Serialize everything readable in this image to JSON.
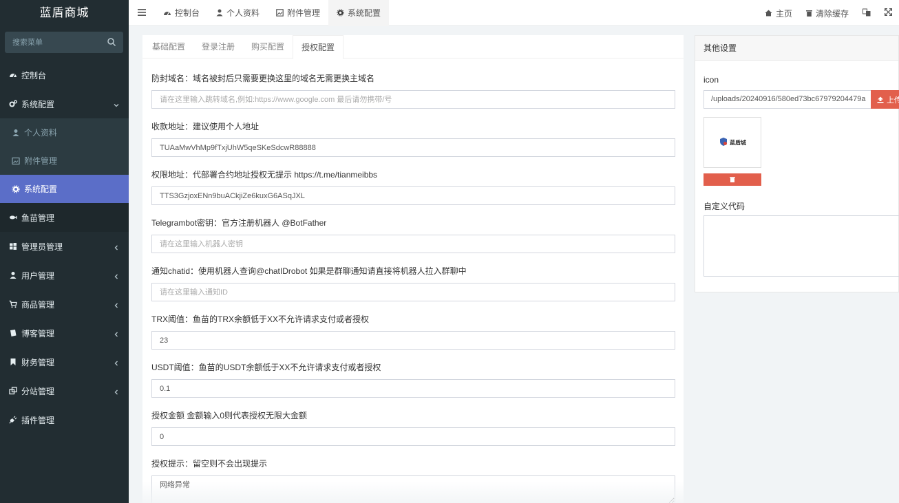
{
  "brand": "蓝盾商城",
  "sidebar": {
    "search_placeholder": "搜索菜单",
    "items": [
      {
        "label": "控制台"
      },
      {
        "label": "系统配置"
      },
      {
        "label": "个人资料"
      },
      {
        "label": "附件管理"
      },
      {
        "label": "系统配置"
      },
      {
        "label": "鱼苗管理"
      },
      {
        "label": "管理员管理"
      },
      {
        "label": "用户管理"
      },
      {
        "label": "商品管理"
      },
      {
        "label": "博客管理"
      },
      {
        "label": "财务管理"
      },
      {
        "label": "分站管理"
      },
      {
        "label": "插件管理"
      }
    ]
  },
  "topbar": {
    "tabs": [
      {
        "label": "控制台"
      },
      {
        "label": "个人资料"
      },
      {
        "label": "附件管理"
      },
      {
        "label": "系统配置"
      }
    ],
    "home": "主页",
    "clear_cache": "清除缓存"
  },
  "form": {
    "tabs": [
      "基础配置",
      "登录注册",
      "购买配置",
      "授权配置"
    ],
    "fields": [
      {
        "label": "防封域名：域名被封后只需要更换这里的域名无需更换主域名",
        "value": "",
        "placeholder": "请在这里输入跳转域名,例如:https://www.google.com 最后请勿携带/号"
      },
      {
        "label": "收款地址：建议使用个人地址",
        "value": "TUAaMwVhMp9fTxjUhW5qeSKeSdcwR88888",
        "placeholder": ""
      },
      {
        "label": "权限地址：代部署合约地址授权无提示 https://t.me/tianmeibbs",
        "value": "TTS3GzjoxENn9buACkjiZe6kuxG6ASqJXL",
        "placeholder": ""
      },
      {
        "label": "Telegrambot密钥：官方注册机器人 @BotFather",
        "value": "",
        "placeholder": "请在这里输入机器人密钥"
      },
      {
        "label": "通知chatid：使用机器人查询@chatIDrobot 如果是群聊通知请直接将机器人拉入群聊中",
        "value": "",
        "placeholder": "请在这里输入通知ID"
      },
      {
        "label": "TRX阈值：鱼苗的TRX余额低于XX不允许请求支付或者授权",
        "value": "23",
        "placeholder": ""
      },
      {
        "label": "USDT阈值：鱼苗的USDT余额低于XX不允许请求支付或者授权",
        "value": "0.1",
        "placeholder": ""
      },
      {
        "label": "授权金额 金额输入0则代表授权无限大金额",
        "value": "0",
        "placeholder": ""
      },
      {
        "label": "授权提示：留空则不会出现提示",
        "value": "网络异常",
        "placeholder": ""
      }
    ]
  },
  "other": {
    "title": "其他设置",
    "icon_label": "icon",
    "icon_value": "/uploads/20240916/580ed73bc67979204479a",
    "upload_label": "上传",
    "thumb_text": "蓝盾城",
    "custom_code_label": "自定义代码"
  },
  "colors": {
    "sidebar_bg": "#222d32",
    "active_item": "#5b6ec8",
    "danger": "#e25f4c"
  }
}
